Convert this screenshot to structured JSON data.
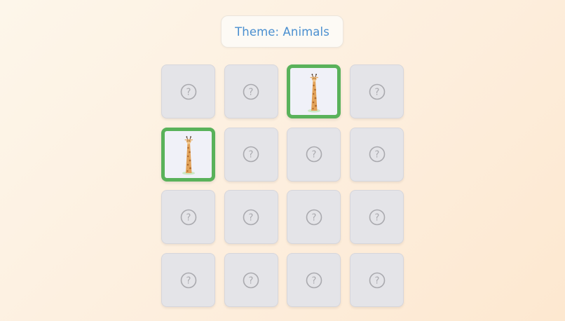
{
  "theme": {
    "label": "Theme: Animals"
  },
  "board": {
    "rows": 4,
    "columns": 4,
    "hidden_symbol": "?",
    "cards": [
      {
        "state": "hidden"
      },
      {
        "state": "hidden"
      },
      {
        "state": "matched",
        "image": "giraffe-icon"
      },
      {
        "state": "hidden"
      },
      {
        "state": "matched",
        "image": "giraffe-icon"
      },
      {
        "state": "hidden"
      },
      {
        "state": "hidden"
      },
      {
        "state": "hidden"
      },
      {
        "state": "hidden"
      },
      {
        "state": "hidden"
      },
      {
        "state": "hidden"
      },
      {
        "state": "hidden"
      },
      {
        "state": "hidden"
      },
      {
        "state": "hidden"
      },
      {
        "state": "hidden"
      },
      {
        "state": "hidden"
      }
    ]
  },
  "colors": {
    "theme_text": "#4a8fd0",
    "matched_border": "#59b25a",
    "card_back": "#e4e4e8",
    "question_mark": "#a9a9ae"
  }
}
